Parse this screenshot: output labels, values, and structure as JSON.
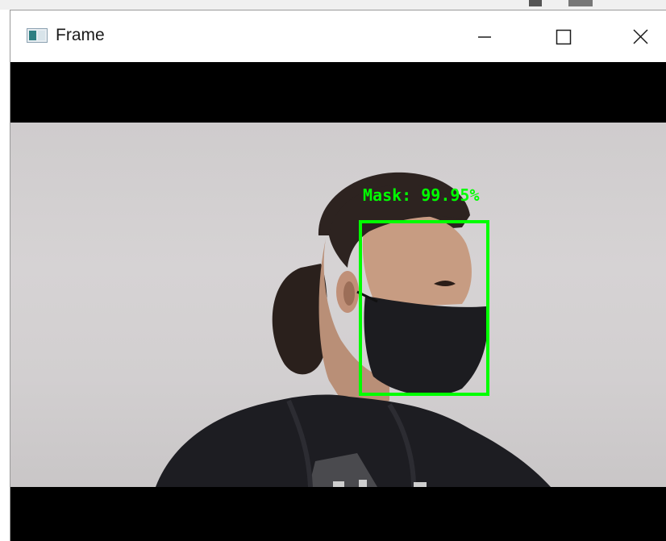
{
  "window": {
    "title": "Frame",
    "icons": {
      "app": "window-app-icon",
      "minimize": "minimize-icon",
      "maximize": "maximize-icon",
      "close": "close-icon"
    }
  },
  "frame": {
    "detection": {
      "label": "Mask: 99.95%",
      "color": "#00ff00"
    },
    "letterbox_color": "#000000"
  }
}
